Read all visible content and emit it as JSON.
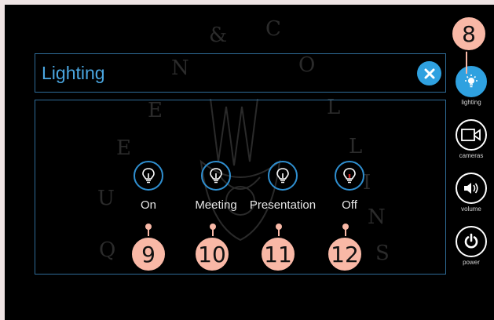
{
  "window": {
    "title": "Lighting"
  },
  "presets": [
    {
      "label": "On",
      "icon": "lightbulb-icon"
    },
    {
      "label": "Meeting",
      "icon": "lightbulb-icon"
    },
    {
      "label": "Presentation",
      "icon": "lightbulb-icon"
    },
    {
      "label": "Off",
      "icon": "lightbulb-off-icon"
    }
  ],
  "sidebar": [
    {
      "label": "lighting",
      "icon": "lightbulb-icon",
      "active": true
    },
    {
      "label": "cameras",
      "icon": "camera-icon",
      "active": false
    },
    {
      "label": "volume",
      "icon": "speaker-icon",
      "active": false
    },
    {
      "label": "power",
      "icon": "power-icon",
      "active": false
    }
  ],
  "callouts": [
    "8",
    "9",
    "10",
    "11",
    "12"
  ],
  "watermark": {
    "letters": [
      "Q",
      "U",
      "E",
      "E",
      "N",
      "&",
      "C",
      "O",
      "L",
      "L",
      "I",
      "N",
      "S"
    ]
  },
  "colors": {
    "accent": "#2fa1e0",
    "border": "#2f6c98",
    "callout": "#f9b8a6"
  }
}
